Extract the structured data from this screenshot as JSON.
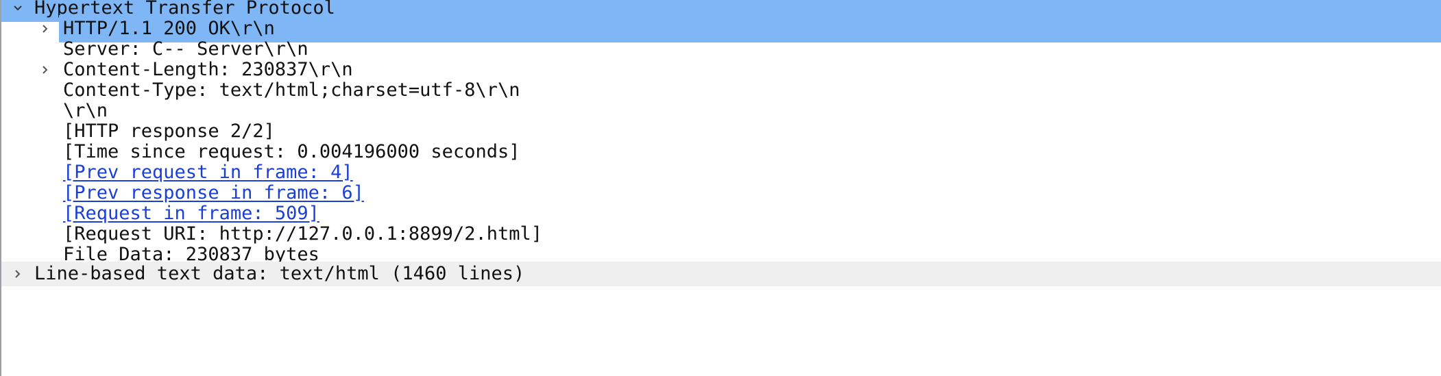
{
  "tree": {
    "root": {
      "label": "Hypertext Transfer Protocol",
      "expanded": true,
      "icon": "chevron-down-icon"
    },
    "children": [
      {
        "label": "HTTP/1.1 200 OK\\r\\n",
        "expandable": true,
        "icon": "chevron-right-icon",
        "link": false
      },
      {
        "label": "Server: C-- Server\\r\\n",
        "expandable": false,
        "link": false
      },
      {
        "label": "Content-Length: 230837\\r\\n",
        "expandable": true,
        "icon": "chevron-right-icon",
        "link": false
      },
      {
        "label": "Content-Type:  text/html;charset=utf-8\\r\\n",
        "expandable": false,
        "link": false
      },
      {
        "label": "\\r\\n",
        "expandable": false,
        "link": false
      },
      {
        "label": "[HTTP response 2/2]",
        "expandable": false,
        "link": false
      },
      {
        "label": "[Time since request: 0.004196000 seconds]",
        "expandable": false,
        "link": false
      },
      {
        "label": "[Prev request in frame: 4]",
        "expandable": false,
        "link": true
      },
      {
        "label": "[Prev response in frame: 6]",
        "expandable": false,
        "link": true
      },
      {
        "label": "[Request in frame: 509]",
        "expandable": false,
        "link": true
      },
      {
        "label": "[Request URI: http://127.0.0.1:8899/2.html]",
        "expandable": false,
        "link": false
      },
      {
        "label": "File Data: 230837 bytes",
        "expandable": false,
        "link": false
      }
    ],
    "next": {
      "label": "Line-based text data: text/html (1460 lines)",
      "expanded": false,
      "icon": "chevron-right-icon"
    }
  },
  "colors": {
    "selection": "#7fb6f5",
    "link": "#1a3fd6",
    "text": "#111111",
    "alt_row": "#efefef"
  }
}
